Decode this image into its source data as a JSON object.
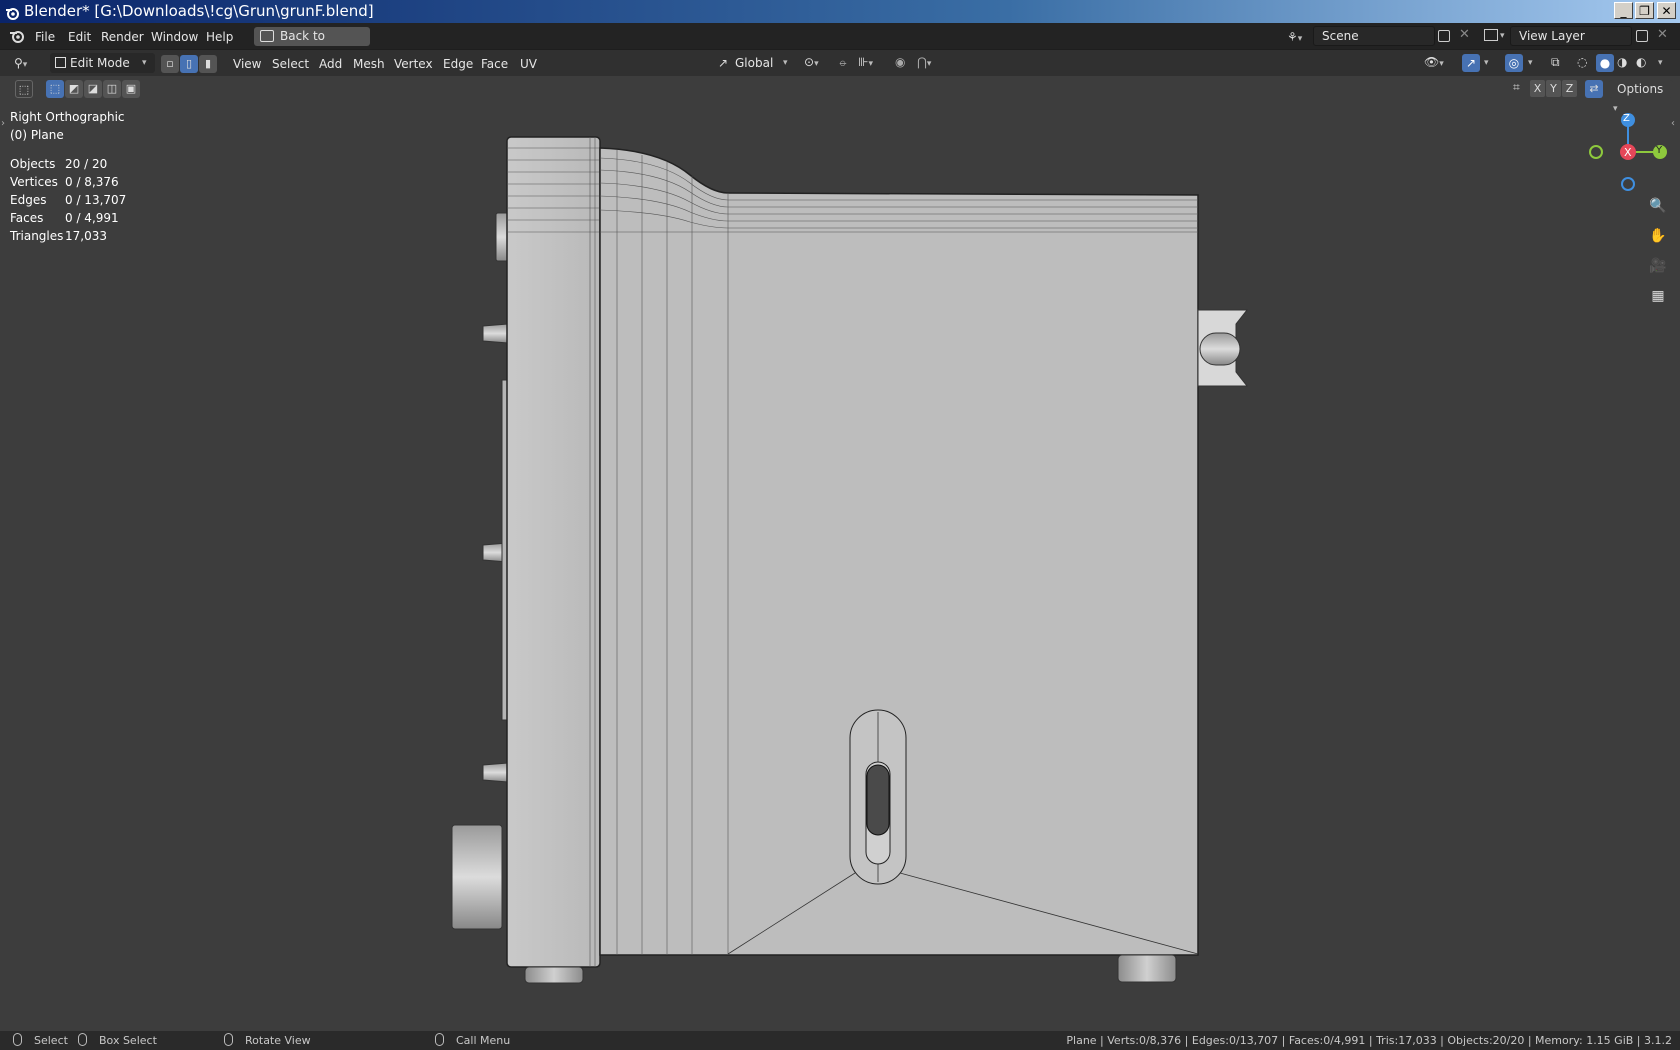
{
  "window": {
    "title": "Blender* [G:\\Downloads\\!cg\\Grun\\grunF.blend]",
    "minimize": "_",
    "maximize": "❐",
    "close": "✕"
  },
  "menubar": {
    "items": [
      "File",
      "Edit",
      "Render",
      "Window",
      "Help"
    ],
    "back_button": "Back to Previous",
    "scene_label": "Scene",
    "view_layer_label": "View Layer"
  },
  "header": {
    "mode": "Edit Mode",
    "menus": [
      "View",
      "Select",
      "Add",
      "Mesh",
      "Vertex",
      "Edge",
      "Face",
      "UV"
    ],
    "transform_orientation": "Global",
    "options_label": "Options",
    "axis_x": "X",
    "axis_y": "Y",
    "axis_z": "Z"
  },
  "viewport": {
    "view_name": "Right Orthographic",
    "object_name": "(0) Plane",
    "stats": [
      {
        "label": "Objects",
        "value": "20 / 20"
      },
      {
        "label": "Vertices",
        "value": "0 / 8,376"
      },
      {
        "label": "Edges",
        "value": "0 / 13,707"
      },
      {
        "label": "Faces",
        "value": "0 / 4,991"
      },
      {
        "label": "Triangles",
        "value": "17,033"
      }
    ],
    "gizmo": {
      "z": "Z",
      "x": "X",
      "y": "Y"
    }
  },
  "statusbar": {
    "select": "Select",
    "box_select": "Box Select",
    "rotate_view": "Rotate View",
    "call_menu": "Call Menu",
    "info": "Plane | Verts:0/8,376 | Edges:0/13,707 | Faces:0/4,991 | Tris:17,033 | Objects:20/20 | Memory: 1.15 GiB | 3.1.2"
  },
  "colors": {
    "accent": "#4772b3",
    "axis_x": "#e64759",
    "axis_y": "#8ec93d",
    "axis_z": "#3f8fe0"
  },
  "icons": [
    "blender-logo-icon",
    "editor-type-icon",
    "search-icon",
    "hand-icon",
    "camera-icon",
    "grid-icon"
  ]
}
